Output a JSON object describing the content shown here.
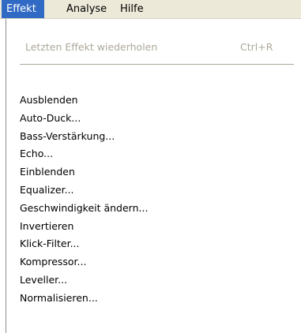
{
  "menubar": {
    "items": [
      {
        "label": "Effekt",
        "active": true
      },
      {
        "label": "Analyse",
        "active": false
      },
      {
        "label": "Hilfe",
        "active": false
      }
    ]
  },
  "dropdown": {
    "repeat": {
      "label": "Letzten Effekt wiederholen",
      "shortcut": "Ctrl+R",
      "enabled": false
    },
    "items": [
      {
        "label": "Ausblenden"
      },
      {
        "label": "Auto-Duck..."
      },
      {
        "label": "Bass-Verstärkung..."
      },
      {
        "label": "Echo..."
      },
      {
        "label": "Einblenden"
      },
      {
        "label": "Equalizer..."
      },
      {
        "label": "Geschwindigkeit ändern..."
      },
      {
        "label": "Invertieren"
      },
      {
        "label": "Klick-Filter..."
      },
      {
        "label": "Kompressor..."
      },
      {
        "label": "Leveller..."
      },
      {
        "label": "Normalisieren..."
      }
    ]
  },
  "colors": {
    "menubar_bg": "#ece9d8",
    "highlight": "#316ac5",
    "disabled_text": "#aca899"
  }
}
